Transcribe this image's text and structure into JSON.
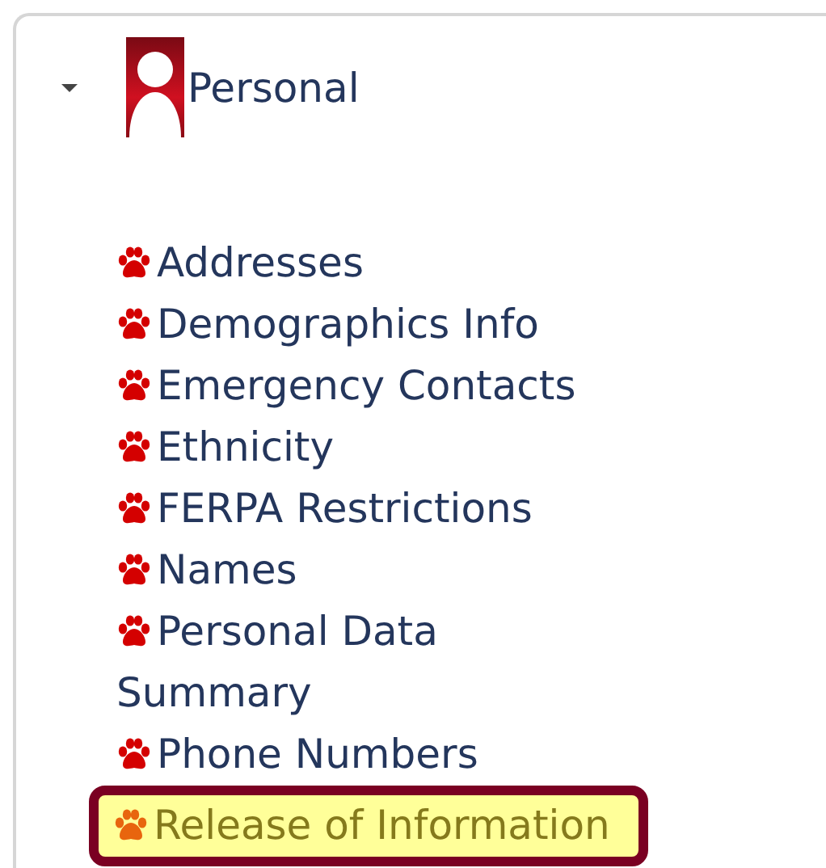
{
  "section": {
    "label": "Personal",
    "expanded": true,
    "items": [
      {
        "label": "Addresses",
        "selected": false
      },
      {
        "label": "Demographics Info",
        "selected": false
      },
      {
        "label": "Emergency Contacts",
        "selected": false
      },
      {
        "label": "Ethnicity",
        "selected": false
      },
      {
        "label": "FERPA Restrictions",
        "selected": false
      },
      {
        "label": "Names",
        "selected": false
      },
      {
        "label": "Personal Data Summary",
        "selected": false
      },
      {
        "label": "Phone Numbers",
        "selected": false
      },
      {
        "label": "Release of Information",
        "selected": true
      }
    ]
  }
}
